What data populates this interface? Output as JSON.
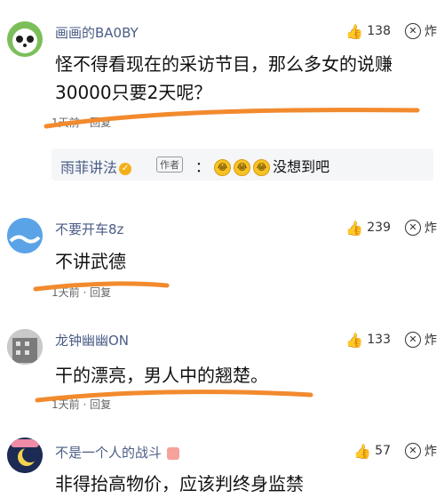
{
  "comments": [
    {
      "username": "画画的BA0BY",
      "likes": "138",
      "hot_label": "炸",
      "content_lines": [
        "怪不得看现在的采访节目，那么多女的说赚",
        "30000只要2天呢？"
      ],
      "meta": "1天前 · 回复",
      "reply": {
        "user": "雨菲讲法",
        "author_tag": "作者",
        "separator": "：",
        "text": "没想到吧"
      }
    },
    {
      "username": "不要开车8z",
      "likes": "239",
      "hot_label": "炸",
      "content_lines": [
        "不讲武德"
      ],
      "meta": "1天前 · 回复"
    },
    {
      "username": "龙钟幽幽ON",
      "likes": "133",
      "hot_label": "炸",
      "content_lines": [
        "干的漂亮，男人中的翘楚。"
      ],
      "meta": "1天前 · 回复"
    },
    {
      "username": "不是一个人的战斗",
      "likes": "57",
      "hot_label": "炸",
      "content_lines": [
        "非得抬高物价，应该判终身监禁"
      ]
    }
  ],
  "colors": {
    "username": "#4a5d86",
    "underline": "#f28a2e"
  }
}
